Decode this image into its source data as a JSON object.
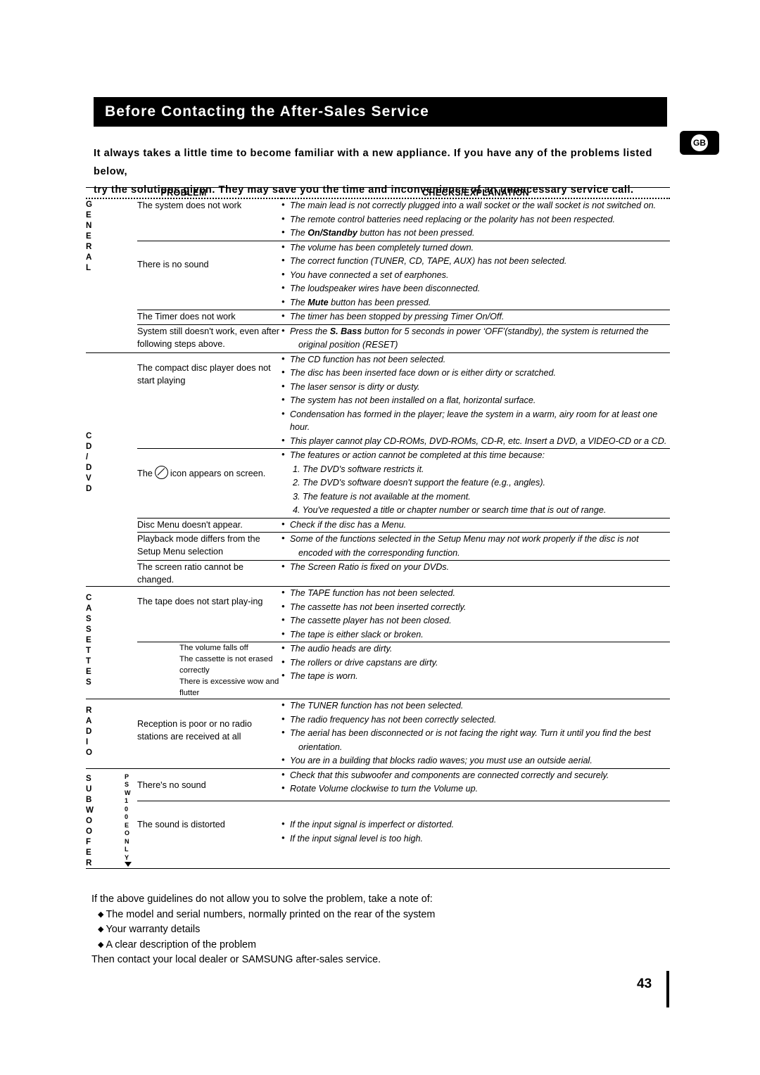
{
  "page": {
    "title": "Before Contacting the After-Sales Service",
    "region_badge": "GB",
    "page_number": "43",
    "intro_line1": "It always takes a little time to become familiar with a new appliance. If you have any of the problems listed below,",
    "intro_line2": "try the solutions given. They may save you the time and inconvenience of an unnecessary service call."
  },
  "table": {
    "header_problem": "PROBLEM",
    "header_checks": "CHECKS/EXPLANATION",
    "categories": {
      "general": [
        "G",
        "E",
        "N",
        "E",
        "R",
        "A",
        "L"
      ],
      "cd_dvd": [
        "C",
        "D",
        "/",
        "D",
        "V",
        "D"
      ],
      "cassette": [
        "C",
        "A",
        "S",
        "S",
        "E",
        "T",
        "T",
        "E",
        "S"
      ],
      "radio": [
        "R",
        "A",
        "D",
        "I",
        "O"
      ],
      "subwoofer": [
        "S",
        "U",
        "B",
        "W",
        "O",
        "O",
        "F",
        "E",
        "R"
      ],
      "subwoofer2": [
        "P",
        "S",
        "W",
        "1",
        "0",
        "0",
        "E",
        "O",
        "N",
        "L",
        "Y"
      ]
    },
    "rows": [
      {
        "problem": "The system does not work",
        "checks": [
          {
            "type": "bullet",
            "text": "The main lead is not correctly plugged into a wall socket or the wall socket is not switched on."
          },
          {
            "type": "bullet",
            "text": "The remote control batteries need replacing or the polarity has not been respected."
          },
          {
            "type": "bullet",
            "text": "The On/Standby button has not been pressed.",
            "bold": "On/Standby"
          }
        ]
      },
      {
        "problem": "There is no sound",
        "checks": [
          {
            "type": "bullet",
            "text": "The volume has been completely turned down."
          },
          {
            "type": "bullet",
            "text": "The correct function (TUNER, CD, TAPE, AUX) has not been selected."
          },
          {
            "type": "bullet",
            "text": "You have connected a set of earphones."
          },
          {
            "type": "bullet",
            "text": "The loudspeaker wires have been disconnected."
          },
          {
            "type": "bullet",
            "text": "The Mute button has been pressed.",
            "bold": "Mute"
          }
        ]
      },
      {
        "problem": "The Timer does not work",
        "checks": [
          {
            "type": "bullet",
            "text": "The timer has been stopped by pressing Timer On/Off."
          }
        ]
      },
      {
        "problem": "System still doesn't work, even after following steps above.",
        "checks": [
          {
            "type": "bullet",
            "text": "Press the S. Bass button for 5 seconds in power 'OFF'(standby), the system is returned the",
            "bold": "S. Bass"
          },
          {
            "type": "cont",
            "text": "original position (RESET)"
          }
        ]
      },
      {
        "problem": "The compact disc player does not start playing",
        "checks": [
          {
            "type": "bullet",
            "text": "The CD function has not been selected."
          },
          {
            "type": "bullet",
            "text": "The disc has been inserted face down or is either dirty or scratched."
          },
          {
            "type": "bullet",
            "text": "The laser sensor is dirty or dusty."
          },
          {
            "type": "bullet",
            "text": "The system has not been installed on a flat, horizontal surface."
          },
          {
            "type": "bullet",
            "text": "Condensation has formed in the player; leave the system in a warm, airy room for at least one hour."
          },
          {
            "type": "bullet",
            "text": "This player cannot play CD-ROMs, DVD-ROMs, CD-R, etc. Insert a DVD, a VIDEO-CD or a CD."
          }
        ]
      },
      {
        "problem_pre": "The",
        "problem_post": "icon appears on screen.",
        "problem_icon": "no-entry-icon",
        "checks": [
          {
            "type": "bullet",
            "text": "The features or action cannot be completed at this time because:"
          },
          {
            "type": "num",
            "text": "1. The DVD's software restricts it."
          },
          {
            "type": "num",
            "text": "2. The DVD's software doesn't support the feature (e.g., angles)."
          },
          {
            "type": "num",
            "text": "3. The feature is not available at the moment."
          },
          {
            "type": "num",
            "text": "4. You've requested a title or chapter number or search time that is out of range."
          }
        ]
      },
      {
        "problem": "Disc Menu doesn't appear.",
        "checks": [
          {
            "type": "bullet",
            "text": "Check if the disc has a Menu."
          }
        ]
      },
      {
        "problem": "Playback mode differs from the Setup Menu selection",
        "checks": [
          {
            "type": "bullet",
            "text": "Some of the functions selected in the Setup Menu may not work properly if the disc is not"
          },
          {
            "type": "cont",
            "text": "encoded with the corresponding function."
          }
        ]
      },
      {
        "problem": "The screen ratio cannot be changed.",
        "checks": [
          {
            "type": "bullet",
            "text": "The Screen Ratio is fixed on your DVDs."
          }
        ]
      },
      {
        "problem": "The tape does not start play-ing",
        "checks": [
          {
            "type": "bullet",
            "text": "The TAPE function has not been selected."
          },
          {
            "type": "bullet",
            "text": "The cassette has not been inserted correctly."
          },
          {
            "type": "bullet",
            "text": "The cassette player has not been closed."
          },
          {
            "type": "bullet",
            "text": "The tape is either slack or broken."
          }
        ]
      },
      {
        "problem_multi": [
          "The volume falls off",
          "The cassette is not erased correctly",
          "There is excessive wow and flutter"
        ],
        "checks": [
          {
            "type": "bullet",
            "text": "The audio heads are dirty."
          },
          {
            "type": "bullet",
            "text": "The rollers or drive capstans are dirty."
          },
          {
            "type": "bullet",
            "text": "The tape is worn."
          }
        ]
      },
      {
        "problem": "Reception is poor or no radio stations are received at all",
        "checks": [
          {
            "type": "bullet",
            "text": "The TUNER function has not been selected."
          },
          {
            "type": "bullet",
            "text": "The radio frequency has not been correctly selected."
          },
          {
            "type": "bullet",
            "text": "The aerial has been disconnected or is not facing the right way. Turn it until you find the best"
          },
          {
            "type": "cont",
            "text": "orientation."
          },
          {
            "type": "bullet",
            "text": "You are in a building that blocks radio waves; you must use an outside aerial."
          }
        ]
      },
      {
        "problem": "There's no sound",
        "checks": [
          {
            "type": "bullet",
            "text": "Check that this subwoofer and components are connected correctly and securely."
          },
          {
            "type": "bullet",
            "text": "Rotate Volume clockwise to turn the Volume up."
          }
        ]
      },
      {
        "problem": "The sound is distorted",
        "checks": [
          {
            "type": "bullet",
            "text": "If the input signal is imperfect or distorted."
          },
          {
            "type": "bullet",
            "text": "If the input signal level is too high."
          }
        ]
      }
    ]
  },
  "footer": {
    "line1": "If the above guidelines do not allow you to solve the problem, take a note of:",
    "bullet1": "The model and serial numbers, normally printed on the rear of the system",
    "bullet2": "Your warranty details",
    "bullet3": "A clear description of the problem",
    "line2": "Then contact your local dealer or SAMSUNG after-sales service."
  }
}
